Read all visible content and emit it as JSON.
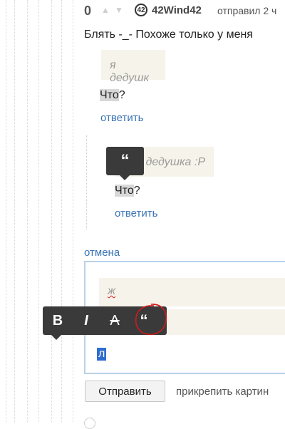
{
  "comment": {
    "score": "0",
    "karma": "42",
    "username": "42Wind42",
    "meta": "отправил 2 ч",
    "text": "Блять -_- Похоже только у меня"
  },
  "reply1": {
    "quote": "я дедушк",
    "text_highlight": "Что",
    "text_rest": "?",
    "reply_link": "ответить"
  },
  "reply2": {
    "quote": "дедушка :P",
    "text_highlight": "Что",
    "text_rest": "?",
    "reply_link": "ответить",
    "quote_tooltip": "“"
  },
  "reply_form": {
    "cancel_link": "отмена",
    "quote_text": "ж",
    "editor_text": "л",
    "submit_label": "Отправить",
    "attach_label": "прикрепить картин"
  },
  "format_toolbar": {
    "bold": "B",
    "italic": "I",
    "strike": "A",
    "quote": "“"
  },
  "colors": {
    "accent_link": "#3a74b5",
    "annotation": "#d01a1a"
  }
}
